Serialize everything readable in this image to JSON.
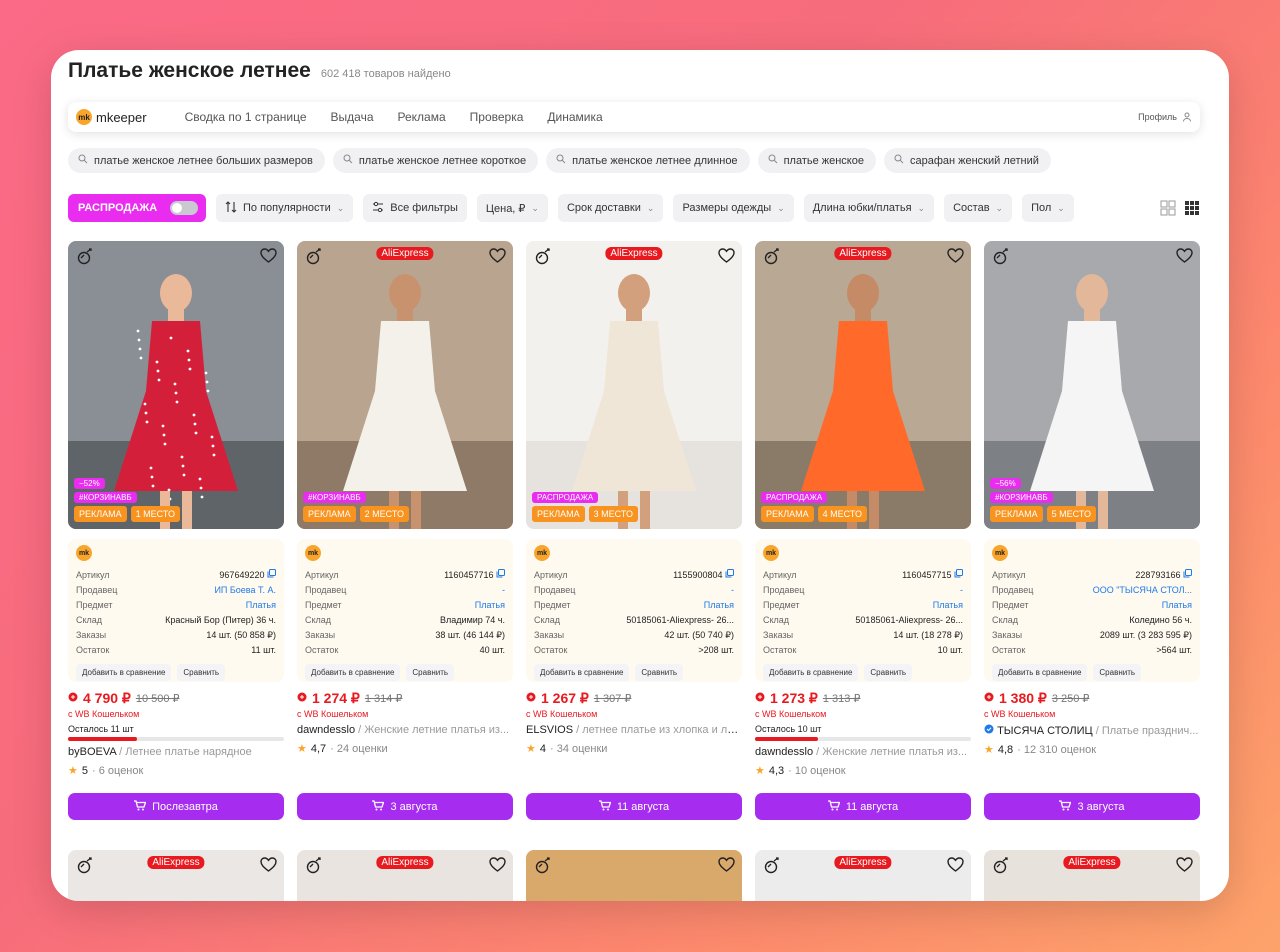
{
  "header": {
    "title": "Платье женское летнее",
    "found": "602 418 товаров найдено"
  },
  "nav": {
    "logo": "mkeeper",
    "logo_mark": "mk",
    "items": [
      "Сводка по 1 странице",
      "Выдача",
      "Реклама",
      "Проверка",
      "Динамика"
    ],
    "profile": "Профиль"
  },
  "tags": [
    "платье женское летнее больших размеров",
    "платье женское летнее короткое",
    "платье женское летнее длинное",
    "платье женское",
    "сарафан женский летний"
  ],
  "filters": {
    "sale": "РАСПРОДАЖА",
    "items": [
      "По популярности",
      "Все фильтры",
      "Цена, ₽",
      "Срок доставки",
      "Размеры одежды",
      "Длина юбки/платья",
      "Состав",
      "Пол"
    ]
  },
  "labels": {
    "article": "Артикул",
    "seller": "Продавец",
    "subject": "Предмет",
    "warehouse": "Склад",
    "orders": "Заказы",
    "stock": "Остаток",
    "add_compare": "Добавить в сравнение",
    "compare": "Сравнить",
    "wallet": "с WB Кошельком",
    "aliexpress": "AliExpress"
  },
  "colors": {
    "accent": "#a62cf0",
    "sale": "#e92cf0",
    "price": "#e8191f",
    "badge": "#f7931e"
  },
  "products": [
    {
      "discount": "−52%",
      "tag": "#КОРЗИНАВБ",
      "ad": "РЕКЛАМА",
      "place": "1 МЕСТО",
      "aliexpress": false,
      "article": "967649220",
      "seller": "ИП Боева Т. А.",
      "subject": "Платья",
      "warehouse": "Красный Бор (Питер) 36 ч.",
      "orders": "14 шт. (50 858 ₽)",
      "stock": "11 шт.",
      "price": "4 790 ₽",
      "old": "10 500 ₽",
      "left": "Осталось 11 шт",
      "left_pct": 32,
      "brand": "byBOEVA",
      "name": "Летнее платье нарядное",
      "rating": "5",
      "reviews": "· 6 оценок",
      "delivery": "Послезавтра"
    },
    {
      "discount": "",
      "tag": "#КОРЗИНАВБ",
      "ad": "РЕКЛАМА",
      "place": "2 МЕСТО",
      "aliexpress": true,
      "article": "1160457716",
      "seller": "-",
      "subject": "Платья",
      "warehouse": "Владимир 74 ч.",
      "orders": "38 шт. (46 144 ₽)",
      "stock": "40 шт.",
      "price": "1 274 ₽",
      "old": "1 314 ₽",
      "left": "",
      "left_pct": 0,
      "brand": "dawndesslo",
      "name": "Женские летние платья из...",
      "rating": "4,7",
      "reviews": "· 24 оценки",
      "delivery": "3 августа"
    },
    {
      "discount": "",
      "tag": "РАСПРОДАЖА",
      "ad": "РЕКЛАМА",
      "place": "3 МЕСТО",
      "aliexpress": true,
      "article": "1155900804",
      "seller": "-",
      "subject": "Платья",
      "warehouse": "50185061-Aliexpress- 26...",
      "orders": "42 шт. (50 740 ₽)",
      "stock": ">208 шт.",
      "price": "1 267 ₽",
      "old": "1 307 ₽",
      "left": "",
      "left_pct": 0,
      "brand": "ELSVIOS",
      "name": "летнее платье из хлопка и льна",
      "rating": "4",
      "reviews": "· 34 оценки",
      "delivery": "11 августа"
    },
    {
      "discount": "",
      "tag": "РАСПРОДАЖА",
      "ad": "РЕКЛАМА",
      "place": "4 МЕСТО",
      "aliexpress": true,
      "article": "1160457715",
      "seller": "-",
      "subject": "Платья",
      "warehouse": "50185061-Aliexpress- 26...",
      "orders": "14 шт. (18 278 ₽)",
      "stock": "10 шт.",
      "price": "1 273 ₽",
      "old": "1 313 ₽",
      "left": "Осталось 10 шт",
      "left_pct": 29,
      "brand": "dawndesslo",
      "name": "Женские летние платья из...",
      "rating": "4,3",
      "reviews": "· 10 оценок",
      "delivery": "11 августа"
    },
    {
      "discount": "−56%",
      "tag": "#КОРЗИНАВБ",
      "ad": "РЕКЛАМА",
      "place": "5 МЕСТО",
      "aliexpress": false,
      "article": "228793166",
      "seller": "ООО \"ТЫСЯЧА СТОЛ...",
      "subject": "Платья",
      "warehouse": "Коледино 56 ч.",
      "orders": "2089 шт. (3 283 595 ₽)",
      "stock": ">564 шт.",
      "price": "1 380 ₽",
      "old": "3 250 ₽",
      "left": "",
      "left_pct": 0,
      "brand": "ТЫСЯЧА СТОЛИЦ",
      "name": "Платье празднич...",
      "rating": "4,8",
      "reviews": "· 12 310 оценок",
      "delivery": "3 августа"
    }
  ]
}
